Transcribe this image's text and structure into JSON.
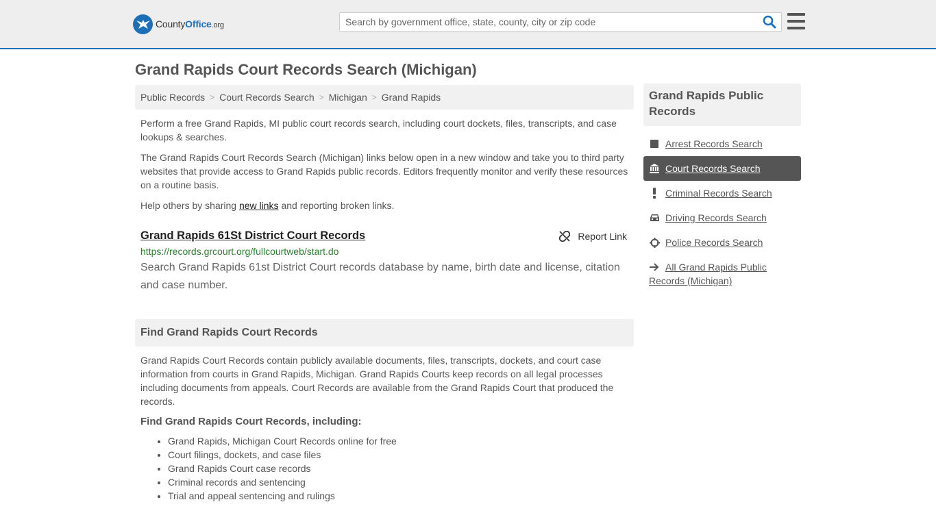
{
  "header": {
    "logo_main": "County",
    "logo_bold": "Office",
    "logo_suffix": ".org",
    "search_placeholder": "Search by government office, state, county, city or zip code",
    "brand_color": "#1d6fb8"
  },
  "page": {
    "title": "Grand Rapids Court Records Search (Michigan)"
  },
  "breadcrumb": [
    "Public Records",
    "Court Records Search",
    "Michigan",
    "Grand Rapids"
  ],
  "intro": {
    "p1": "Perform a free Grand Rapids, MI public court records search, including court dockets, files, transcripts, and case lookups & searches.",
    "p2": "The Grand Rapids Court Records Search (Michigan) links below open in a new window and take you to third party websites that provide access to Grand Rapids public records. Editors frequently monitor and verify these resources on a routine basis.",
    "p3_before": "Help others by sharing ",
    "p3_link": "new links",
    "p3_after": " and reporting broken links."
  },
  "result": {
    "title": "Grand Rapids 61St District Court Records",
    "url": "https://records.grcourt.org/fullcourtweb/start.do",
    "description": "Search Grand Rapids 61st District Court records database by name, birth date and license, citation and case number.",
    "report_label": "Report Link"
  },
  "find_section": {
    "heading": "Find Grand Rapids Court Records",
    "paragraph": "Grand Rapids Court Records contain publicly available documents, files, transcripts, dockets, and court case information from courts in Grand Rapids, Michigan. Grand Rapids Courts keep records on all legal processes including documents from appeals. Court Records are available from the Grand Rapids Court that produced the records.",
    "subheading": "Find Grand Rapids Court Records, including:",
    "items": [
      "Grand Rapids, Michigan Court Records online for free",
      "Court filings, dockets, and case files",
      "Grand Rapids Court case records",
      "Criminal records and sentencing",
      "Trial and appeal sentencing and rulings"
    ]
  },
  "sidebar": {
    "heading": "Grand Rapids Public Records",
    "items": [
      {
        "label": "Arrest Records Search",
        "icon": "square-icon"
      },
      {
        "label": "Court Records Search",
        "icon": "courthouse-icon",
        "active": true
      },
      {
        "label": "Criminal Records Search",
        "icon": "exclamation-icon"
      },
      {
        "label": "Driving Records Search",
        "icon": "car-icon"
      },
      {
        "label": "Police Records Search",
        "icon": "crosshair-icon"
      },
      {
        "label": "All Grand Rapids Public Records (Michigan)",
        "icon": "arrow-right-icon"
      }
    ]
  }
}
